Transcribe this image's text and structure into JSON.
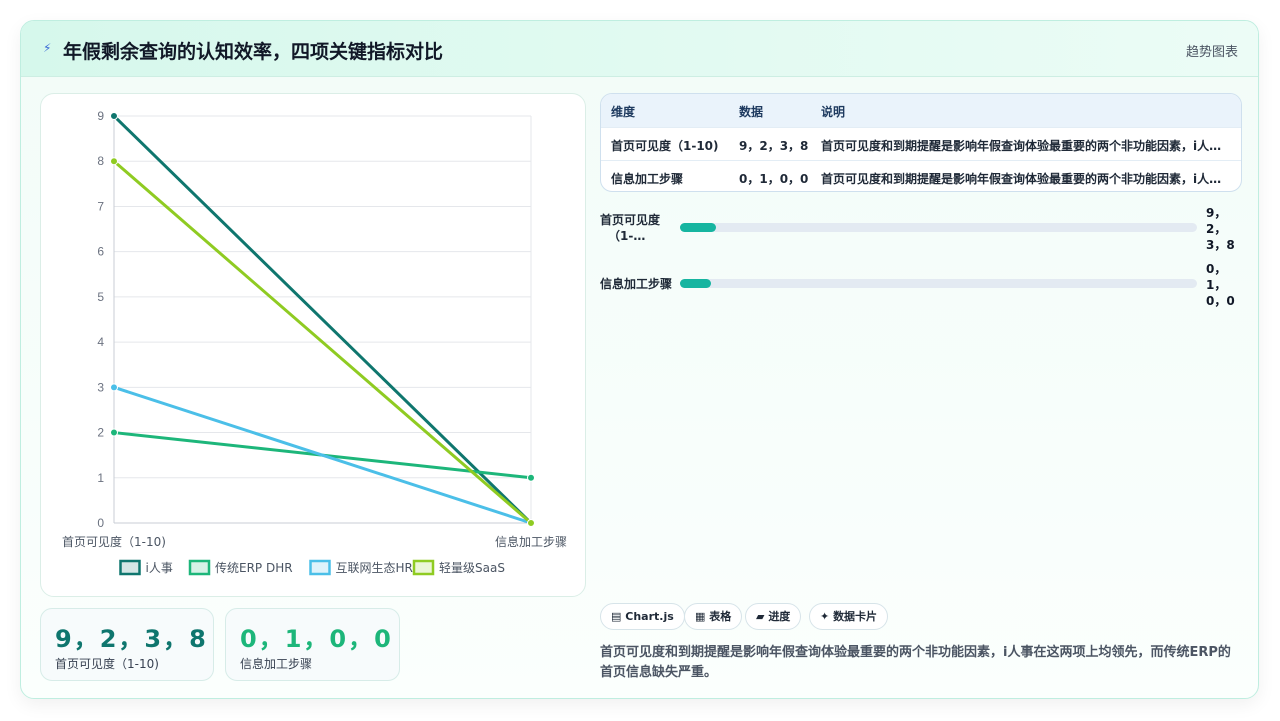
{
  "header": {
    "icon": "lightning-icon",
    "title": "年假剩余查询的认知效率，四项关键指标对比",
    "badge": "趋势图表"
  },
  "chart_data": {
    "type": "line",
    "categories": [
      "首页可见度（1-10)",
      "信息加工步骤"
    ],
    "series": [
      {
        "name": "i人事",
        "values": [
          9,
          0
        ],
        "color": "#0f766e"
      },
      {
        "name": "传统ERP DHR",
        "values": [
          2,
          1
        ],
        "color": "#1db67a"
      },
      {
        "name": "互联网生态HR",
        "values": [
          3,
          0
        ],
        "color": "#4bbfe8"
      },
      {
        "name": "轻量级SaaS",
        "values": [
          8,
          0
        ],
        "color": "#8fcb22"
      }
    ],
    "ylim": [
      0,
      9
    ],
    "yticks": [
      "0",
      "1",
      "2",
      "3",
      "4",
      "5",
      "6",
      "7",
      "8",
      "9"
    ],
    "legend": "bottom",
    "grid": true
  },
  "stats": [
    {
      "value": "9，2，3，8",
      "label": "首页可见度（1-10)",
      "color": "#0f766e"
    },
    {
      "value": "0，1，0，0",
      "label": "信息加工步骤",
      "color": "#1db67a"
    }
  ],
  "table": {
    "headers": [
      "维度",
      "数据",
      "说明"
    ],
    "rows": [
      [
        "首页可见度（1-10)",
        "9，2，3，8",
        "首页可见度和到期提醒是影响年假查询体验最重要的两个非功能因素，i人事在这两项上均领先，而传统ERP的首页信息缺失严重。"
      ],
      [
        "信息加工步骤",
        "0，1，0，0",
        "首页可见度和到期提醒是影响年假查询体验最重要的两个非功能因素，i人事在这两项上均领先，而传统ERP的首页信息缺失严重。"
      ]
    ]
  },
  "progress": [
    {
      "label_lines": [
        "首页可见度",
        "（1-…"
      ],
      "value_lines": [
        "9，",
        "2，",
        "3，8"
      ],
      "fraction": 0.07
    },
    {
      "label_lines": [
        "信息加工步骤"
      ],
      "value_lines": [
        "0，",
        "1，",
        "0，0"
      ],
      "fraction": 0.06
    }
  ],
  "chips": [
    {
      "icon": "chart-icon",
      "glyph": "▤",
      "label": "Chart.js"
    },
    {
      "icon": "table-icon",
      "glyph": "▦",
      "label": "表格"
    },
    {
      "icon": "progress-icon",
      "glyph": "▰",
      "label": "进度"
    },
    {
      "icon": "card-icon",
      "glyph": "✦",
      "label": "数据卡片"
    }
  ],
  "description": "首页可见度和到期提醒是影响年假查询体验最重要的两个非功能因素，i人事在这两项上均领先，而传统ERP的首页信息缺失严重。"
}
